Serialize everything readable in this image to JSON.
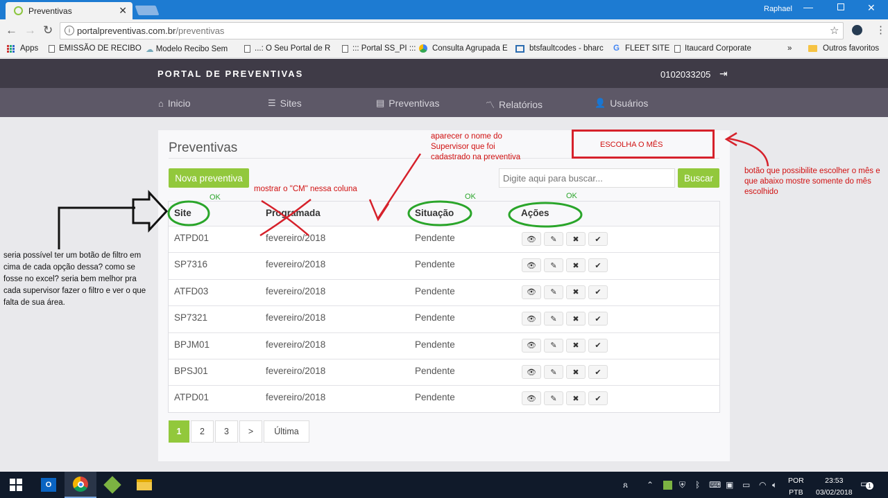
{
  "browser": {
    "tab_title": "Preventivas",
    "tab_close": "✕",
    "user": "Raphael",
    "url_host": "portalpreventivas.com.br",
    "url_path": "/preventivas",
    "bookmarks": [
      "Apps",
      "EMISSÃO DE RECIBO",
      "Modelo Recibo Sem",
      "...: O Seu Portal de R",
      "::: Portal SS_PI :::",
      "Consulta Agrupada E",
      "btsfaultcodes - bharc",
      "FLEET SITE",
      "Itaucard Corporate",
      "Outros favoritos"
    ],
    "bookmarks_more": "»"
  },
  "header": {
    "brand": "PORTAL DE PREVENTIVAS",
    "account": "0102033205",
    "nav": [
      "Inicio",
      "Sites",
      "Preventivas",
      "Relatórios",
      "Usuários"
    ]
  },
  "page": {
    "title": "Preventivas",
    "new_button": "Nova preventiva",
    "search_placeholder": "Digite aqui para buscar...",
    "search_button": "Buscar",
    "columns": [
      "Site",
      "Programada",
      "Situação",
      "Ações"
    ],
    "rows": [
      {
        "site": "ATPD01",
        "programada": "fevereiro/2018",
        "situacao": "Pendente"
      },
      {
        "site": "SP7316",
        "programada": "fevereiro/2018",
        "situacao": "Pendente"
      },
      {
        "site": "ATFD03",
        "programada": "fevereiro/2018",
        "situacao": "Pendente"
      },
      {
        "site": "SP7321",
        "programada": "fevereiro/2018",
        "situacao": "Pendente"
      },
      {
        "site": "BPJM01",
        "programada": "fevereiro/2018",
        "situacao": "Pendente"
      },
      {
        "site": "BPSJ01",
        "programada": "fevereiro/2018",
        "situacao": "Pendente"
      },
      {
        "site": "ATPD01",
        "programada": "fevereiro/2018",
        "situacao": "Pendente"
      }
    ],
    "action_icons": [
      "view-icon",
      "edit-icon",
      "delete-icon",
      "confirm-icon"
    ],
    "pagination": [
      "1",
      "2",
      "3",
      ">",
      "Última"
    ]
  },
  "annotations": {
    "escolha_mes": "ESCOLHA O MÊS",
    "mes_note": "botão que possibilite escolher o mês e que abaixo mostre somente do mês escolhido",
    "supervisor_note": "aparecer o nome do Supervisor que foi cadastrado na preventiva",
    "cm_note": "mostrar o \"CM\" nessa coluna",
    "ok1": "OK",
    "ok2": "OK",
    "ok3": "OK",
    "filter_note": "seria possível ter um botão de filtro em cima de cada opção dessa? como se fosse no excel? seria bem melhor pra cada supervisor fazer o filtro e ver o que falta de sua área."
  },
  "taskbar": {
    "lang1": "POR",
    "lang2": "PTB",
    "time": "23:53",
    "date": "03/02/2018",
    "notif_count": "1"
  },
  "colors": {
    "accent_green": "#92c83c",
    "header_dark": "#3f3b47",
    "nav": "#5d5867",
    "annotation_red": "#d6212b",
    "annotation_green": "#2aa52a"
  }
}
